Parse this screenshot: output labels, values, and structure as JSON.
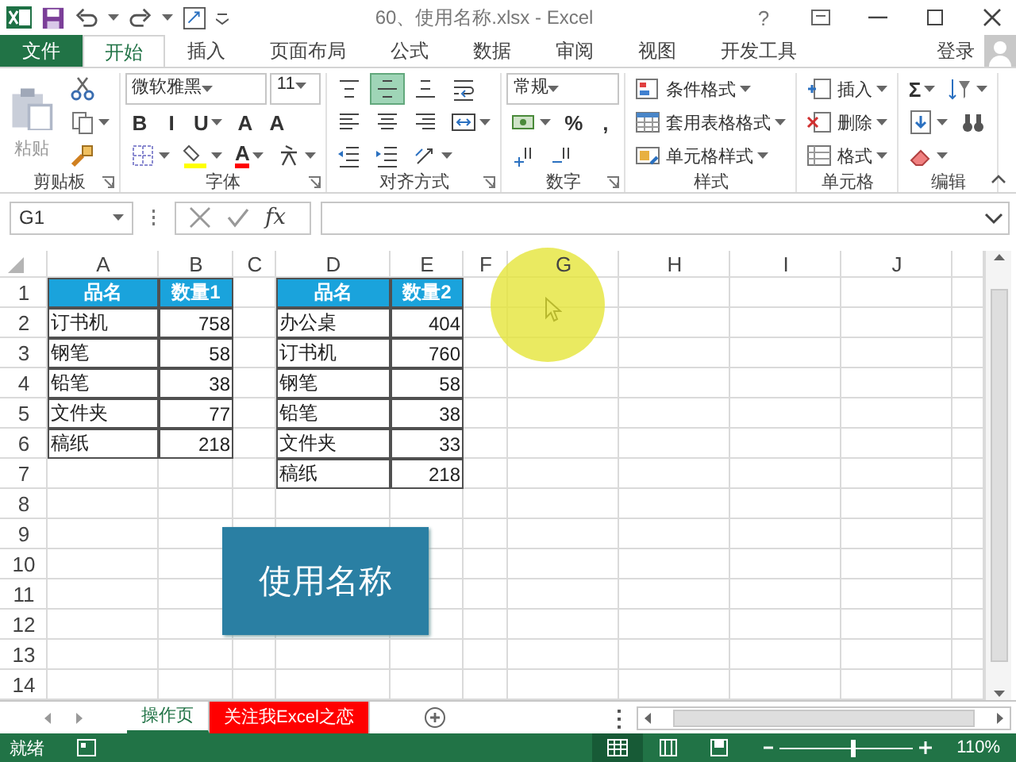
{
  "window": {
    "title": "60、使用名称.xlsx - Excel",
    "help": "?"
  },
  "ribbon_tabs": [
    {
      "label": "文件",
      "kind": "file",
      "selected": false
    },
    {
      "label": "开始",
      "kind": "tab",
      "selected": true
    },
    {
      "label": "插入",
      "kind": "tab",
      "selected": false
    },
    {
      "label": "页面布局",
      "kind": "tab",
      "selected": false
    },
    {
      "label": "公式",
      "kind": "tab",
      "selected": false
    },
    {
      "label": "数据",
      "kind": "tab",
      "selected": false
    },
    {
      "label": "审阅",
      "kind": "tab",
      "selected": false
    },
    {
      "label": "视图",
      "kind": "tab",
      "selected": false
    },
    {
      "label": "开发工具",
      "kind": "tab",
      "selected": false
    }
  ],
  "account": {
    "label": "登录"
  },
  "ribbon_groups": [
    {
      "label": "剪贴板",
      "launcher": true,
      "blocks": [
        {
          "kind": "big",
          "text": "粘贴",
          "disabled": true
        },
        {
          "kind": "stack",
          "lines": [
            [
              {
                "kind": "tool",
                "caret": false
              }
            ],
            [
              {
                "kind": "tool",
                "caret": true
              }
            ],
            [
              {
                "kind": "tool",
                "caret": false
              }
            ]
          ]
        }
      ]
    },
    {
      "label": "字体",
      "launcher": true,
      "blocks": [
        {
          "kind": "stack",
          "lines": [
            [
              {
                "kind": "combo",
                "value": "微软雅黑"
              },
              {
                "kind": "combo",
                "value": "11"
              }
            ],
            [
              {
                "kind": "glyph",
                "text": "B",
                "caret": false
              },
              {
                "kind": "glyph",
                "text": "I",
                "caret": false
              },
              {
                "kind": "glyph",
                "text": "U",
                "caret": true
              },
              {
                "kind": "glyph",
                "text": "A",
                "caret": false
              },
              {
                "kind": "glyph",
                "text": "A",
                "caret": false
              }
            ],
            [
              {
                "kind": "tool",
                "caret": true
              },
              {
                "kind": "tool",
                "caret": true,
                "color": "#ffff00"
              },
              {
                "kind": "glyph",
                "text": "A",
                "caret": true,
                "color": "#ff0000"
              },
              {
                "kind": "tool",
                "caret": true
              }
            ]
          ]
        }
      ]
    },
    {
      "label": "对齐方式",
      "launcher": true,
      "blocks": [
        {
          "kind": "stack",
          "lines": [
            [
              {
                "kind": "tool",
                "caret": false,
                "selected": false
              },
              {
                "kind": "tool",
                "caret": false,
                "selected": true
              },
              {
                "kind": "tool",
                "caret": false,
                "selected": false
              },
              {
                "kind": "tool",
                "caret": false
              }
            ],
            [
              {
                "kind": "tool",
                "caret": false
              },
              {
                "kind": "tool",
                "caret": false
              },
              {
                "kind": "tool",
                "caret": false
              },
              {
                "kind": "tool",
                "caret": true
              }
            ],
            [
              {
                "kind": "tool",
                "caret": false
              },
              {
                "kind": "tool",
                "caret": false
              },
              {
                "kind": "tool",
                "caret": true
              }
            ]
          ]
        }
      ]
    },
    {
      "label": "数字",
      "launcher": true,
      "blocks": [
        {
          "kind": "stack",
          "lines": [
            [
              {
                "kind": "combo",
                "value": "常规"
              }
            ],
            [
              {
                "kind": "tool",
                "caret": true
              },
              {
                "kind": "glyph",
                "text": "%",
                "caret": false
              },
              {
                "kind": "glyph",
                "text": ",",
                "caret": false
              }
            ],
            [
              {
                "kind": "tool",
                "caret": false
              },
              {
                "kind": "tool",
                "caret": false
              }
            ]
          ]
        }
      ]
    },
    {
      "label": "样式",
      "launcher": false,
      "blocks": [
        {
          "kind": "stack",
          "lines": [
            [
              {
                "kind": "labeled",
                "text": "条件格式",
                "caret": true
              }
            ],
            [
              {
                "kind": "labeled",
                "text": "套用表格格式",
                "caret": true
              }
            ],
            [
              {
                "kind": "labeled",
                "text": "单元格样式",
                "caret": true
              }
            ]
          ]
        }
      ]
    },
    {
      "label": "单元格",
      "launcher": false,
      "blocks": [
        {
          "kind": "stack",
          "lines": [
            [
              {
                "kind": "labeled",
                "text": "插入",
                "caret": true
              }
            ],
            [
              {
                "kind": "labeled",
                "text": "删除",
                "caret": true
              }
            ],
            [
              {
                "kind": "labeled",
                "text": "格式",
                "caret": true
              }
            ]
          ]
        }
      ]
    },
    {
      "label": "编辑",
      "launcher": false,
      "blocks": [
        {
          "kind": "stack",
          "lines": [
            [
              {
                "kind": "glyph",
                "text": "Σ",
                "caret": true
              },
              {
                "kind": "tool",
                "caret": true
              }
            ],
            [
              {
                "kind": "tool",
                "caret": true
              },
              {
                "kind": "tool",
                "caret": false
              }
            ],
            [
              {
                "kind": "tool",
                "caret": true
              }
            ]
          ]
        }
      ]
    }
  ],
  "formula_bar": {
    "name_box": "G1",
    "function_label": "fx"
  },
  "columns": [
    "A",
    "B",
    "C",
    "D",
    "E",
    "F",
    "G",
    "H",
    "I",
    "J"
  ],
  "row_numbers": [
    "1",
    "2",
    "3",
    "4",
    "5",
    "6",
    "7",
    "8",
    "9",
    "10",
    "11",
    "12",
    "13",
    "14"
  ],
  "tables": [
    {
      "header": [
        "品名",
        "数量1"
      ],
      "rows": [
        [
          "订书机",
          "758"
        ],
        [
          "钢笔",
          "58"
        ],
        [
          "铅笔",
          "38"
        ],
        [
          "文件夹",
          "77"
        ],
        [
          "稿纸",
          "218"
        ]
      ]
    },
    {
      "header": [
        "品名",
        "数量2"
      ],
      "rows": [
        [
          "办公桌",
          "404"
        ],
        [
          "订书机",
          "760"
        ],
        [
          "钢笔",
          "58"
        ],
        [
          "铅笔",
          "38"
        ],
        [
          "文件夹",
          "33"
        ],
        [
          "稿纸",
          "218"
        ]
      ]
    }
  ],
  "shape": {
    "text": "使用名称"
  },
  "sheet_tabs": [
    {
      "label": "操作页",
      "selected": true
    },
    {
      "label": "关注我Excel之恋",
      "selected": false,
      "color": "#ff0000"
    }
  ],
  "status_bar": {
    "status": "就绪",
    "views": [
      {
        "selected": true
      },
      {
        "selected": false
      },
      {
        "selected": false
      }
    ],
    "zoom_slider": {
      "level": 0.55
    },
    "zoom": "110%"
  }
}
